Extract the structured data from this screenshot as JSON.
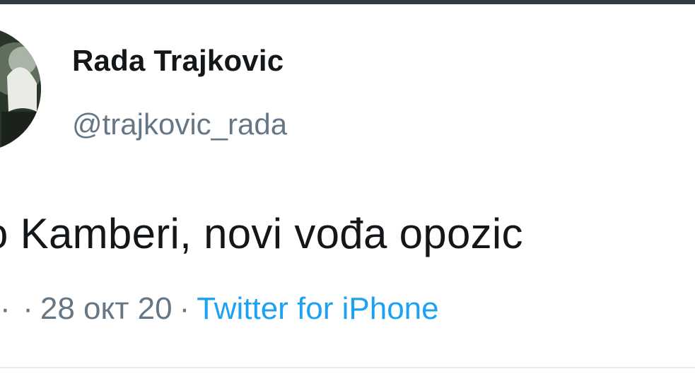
{
  "tweet": {
    "author": {
      "display_name": "Rada Trajkovic",
      "handle": "@trajkovic_rada"
    },
    "text": "o Kamberi, novi vođa opozic",
    "meta": {
      "separator": "·",
      "date": "28 окт 20",
      "source": "Twitter for iPhone"
    }
  },
  "colors": {
    "top_bar": "#2f3a44",
    "name": "#14171a",
    "secondary": "#657786",
    "link": "#1da1f2",
    "divider": "#e6ecf0"
  }
}
